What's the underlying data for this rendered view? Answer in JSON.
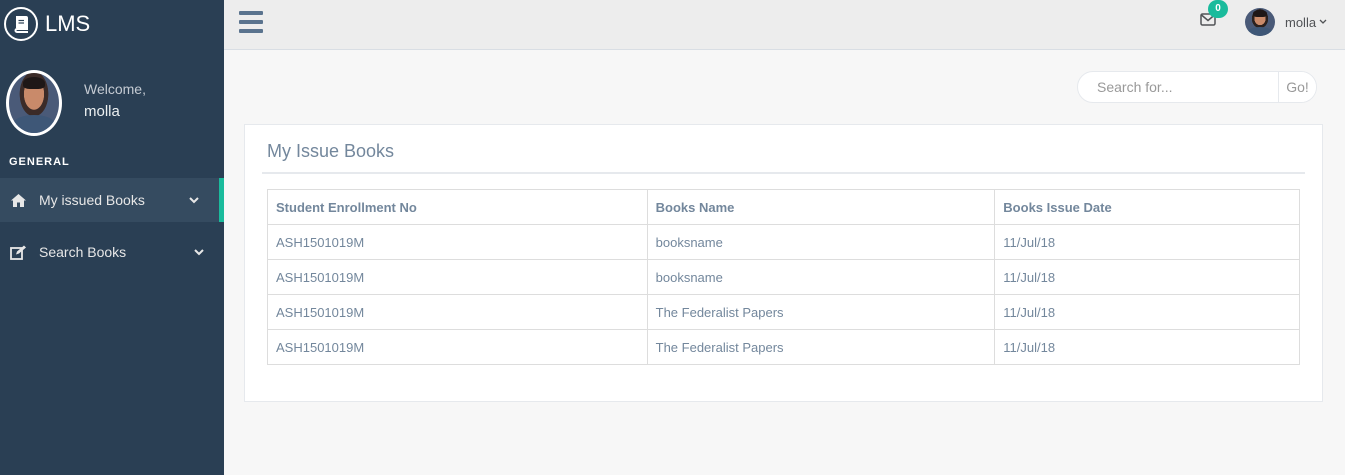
{
  "brand": {
    "title": "LMS",
    "logo_icon": "book-icon"
  },
  "profile": {
    "welcome": "Welcome,",
    "name": "molla"
  },
  "sidebar": {
    "section_title": "GENERAL",
    "items": [
      {
        "label": "My issued Books",
        "icon": "home-icon",
        "active": true
      },
      {
        "label": "Search Books",
        "icon": "edit-icon",
        "active": false
      }
    ]
  },
  "topnav": {
    "mail_badge": "0",
    "user_name": "molla"
  },
  "search": {
    "placeholder": "Search for...",
    "button_label": "Go!"
  },
  "panel": {
    "title": "My Issue Books",
    "columns": [
      "Student Enrollment No",
      "Books Name",
      "Books Issue Date"
    ],
    "rows": [
      [
        "ASH1501019M",
        "booksname",
        "11/Jul/18"
      ],
      [
        "ASH1501019M",
        "booksname",
        "11/Jul/18"
      ],
      [
        "ASH1501019M",
        "The Federalist Papers",
        "11/Jul/18"
      ],
      [
        "ASH1501019M",
        "The Federalist Papers",
        "11/Jul/18"
      ]
    ]
  },
  "colors": {
    "sidebar_bg": "#2a3f54",
    "accent": "#1abb9c",
    "text": "#73879c"
  }
}
